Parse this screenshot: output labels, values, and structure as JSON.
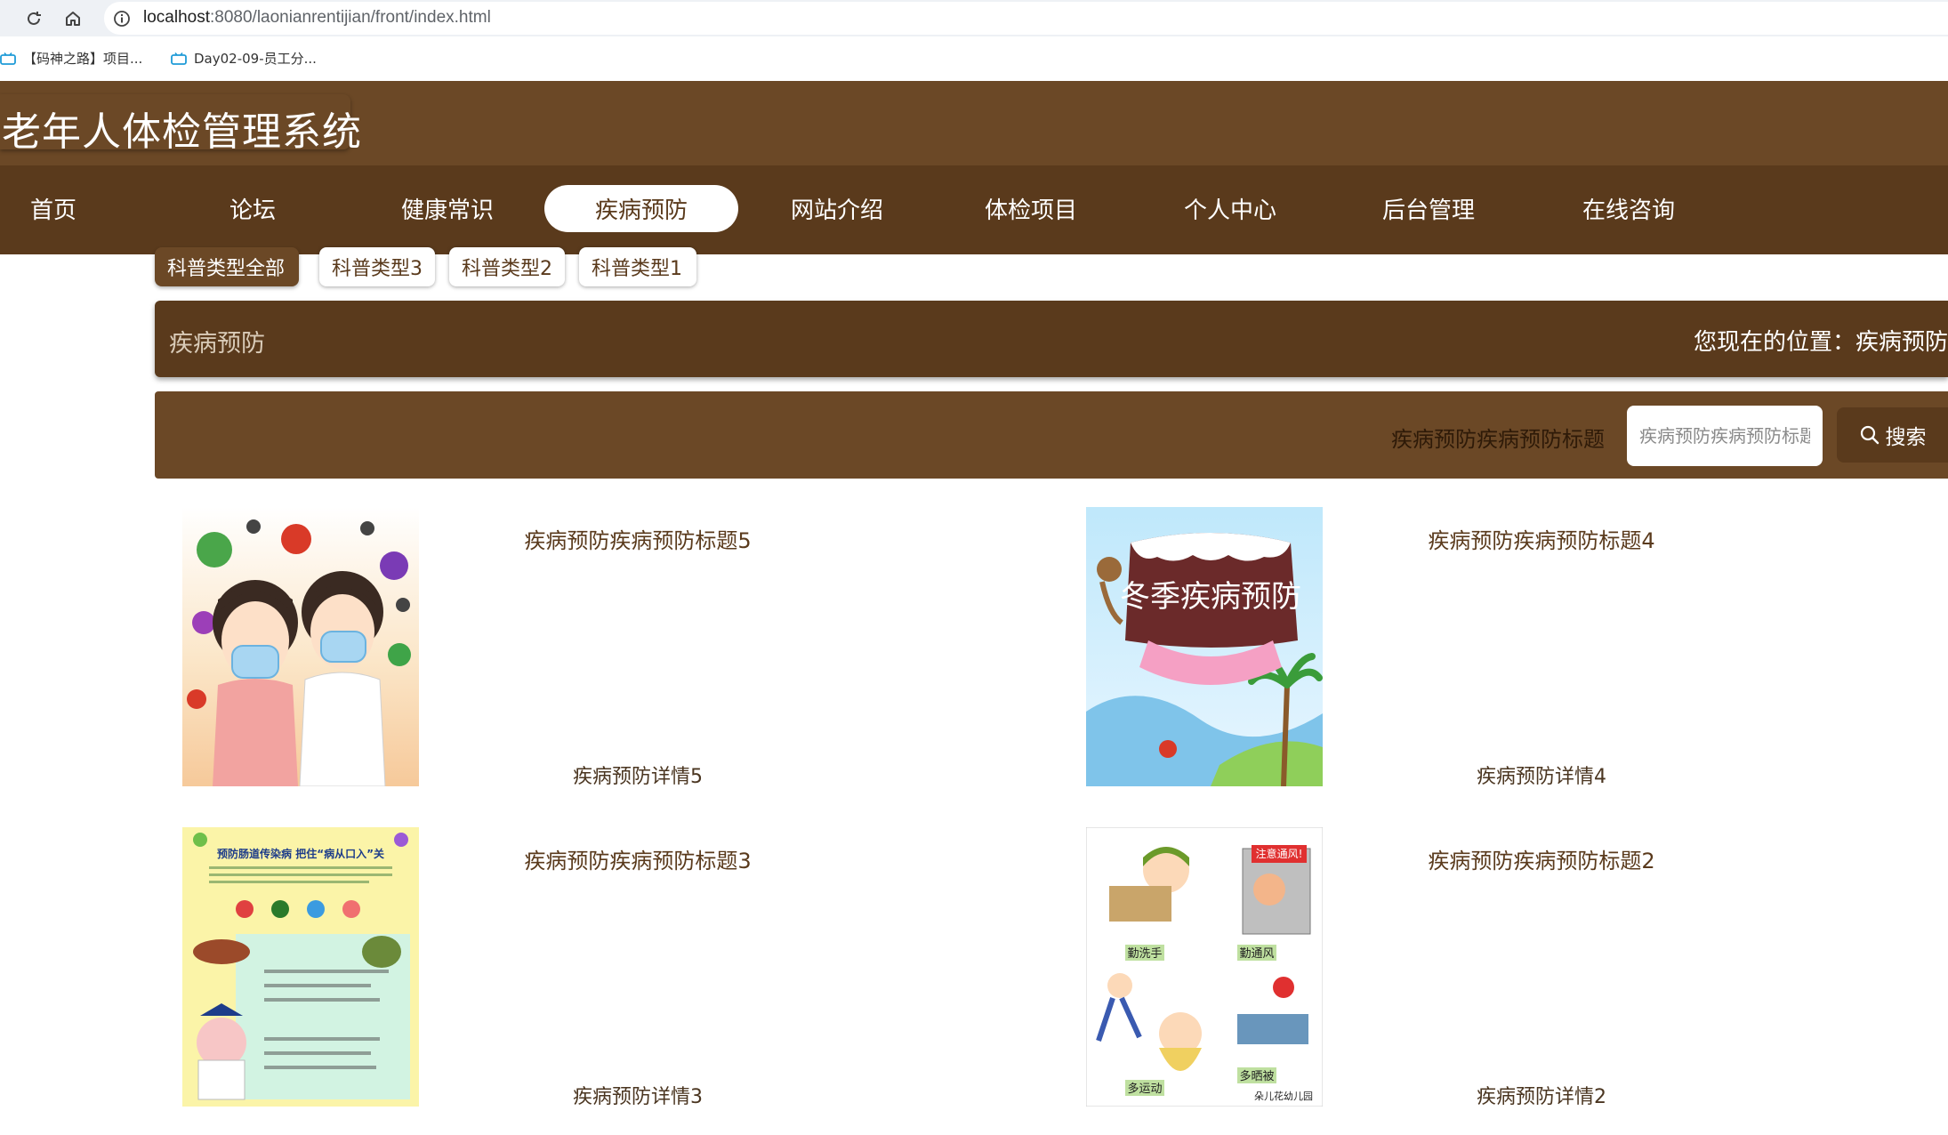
{
  "browser": {
    "url_host": "localhost",
    "url_path": ":8080/laonianrentijian/front/index.html",
    "bookmarks": [
      "【码神之路】项目...",
      "Day02-09-员工分..."
    ]
  },
  "site": {
    "title": "老年人体检管理系统"
  },
  "nav": {
    "items": [
      "首页",
      "论坛",
      "健康常识",
      "疾病预防",
      "网站介绍",
      "体检项目",
      "个人中心",
      "后台管理",
      "在线咨询"
    ],
    "active": "疾病预防"
  },
  "categories": [
    "科普类型全部",
    "科普类型3",
    "科普类型2",
    "科普类型1"
  ],
  "section": {
    "title": "疾病预防",
    "location": "您现在的位置：疾病预防"
  },
  "search": {
    "label": "疾病预防疾病预防标题",
    "placeholder": "疾病预防疾病预防标题",
    "button": "搜索"
  },
  "items": [
    {
      "title": "疾病预防疾病预防标题5",
      "detail": "疾病预防详情5",
      "image": "masked-children-virus"
    },
    {
      "title": "疾病预防疾病预防标题4",
      "detail": "疾病预防详情4",
      "image": "winter-disease-prevention-sign",
      "image_text": "冬季疾病预防"
    },
    {
      "title": "疾病预防疾病预防标题3",
      "detail": "疾病预防详情3",
      "image": "intestinal-disease-poster",
      "image_text": "预防肠道传染病 把住“病从口入”关"
    },
    {
      "title": "疾病预防疾病预防标题2",
      "detail": "疾病预防详情2",
      "image": "kindergarten-health-poster",
      "image_text": [
        "勤洗手",
        "勤通风",
        "注意通风!",
        "多运动",
        "多晒被",
        "朵儿花幼儿园"
      ]
    }
  ],
  "colors": {
    "header": "#6b4826",
    "nav": "#5a3a1c",
    "accent_text": "#5a3a1c"
  }
}
